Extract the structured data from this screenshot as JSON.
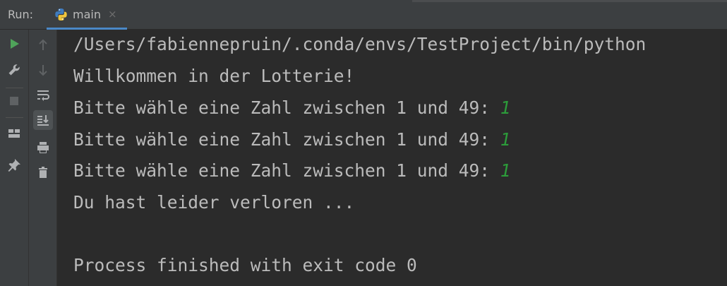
{
  "toolbar": {
    "run_label": "Run:",
    "tab": {
      "title": "main",
      "close_glyph": "×",
      "icon": "python-icon"
    }
  },
  "left_toolbar": {
    "icons": [
      "run-icon",
      "wrench-icon",
      "stop-icon",
      "layout-icon",
      "pin-icon"
    ]
  },
  "right_toolbar": {
    "icons": [
      "arrow-up-icon",
      "arrow-down-icon",
      "soft-wrap-icon",
      "scroll-to-end-icon",
      "print-icon",
      "trash-icon"
    ]
  },
  "console": {
    "lines": [
      {
        "text": "/Users/fabiennepruin/.conda/envs/TestProject/bin/python"
      },
      {
        "text": "Willkommen in der Lotterie!"
      },
      {
        "text": "Bitte wähle eine Zahl zwischen 1 und 49: ",
        "input": "1"
      },
      {
        "text": "Bitte wähle eine Zahl zwischen 1 und 49: ",
        "input": "1"
      },
      {
        "text": "Bitte wähle eine Zahl zwischen 1 und 49: ",
        "input": "1"
      },
      {
        "text": "Du hast leider verloren ..."
      },
      {
        "text": ""
      },
      {
        "text": "Process finished with exit code 0"
      }
    ]
  },
  "colors": {
    "background": "#2b2b2b",
    "panel": "#3c3f41",
    "text": "#bbbbbb",
    "input": "#2c9c3a",
    "run_green": "#4fa35a",
    "tab_underline": "#4a88c7"
  }
}
